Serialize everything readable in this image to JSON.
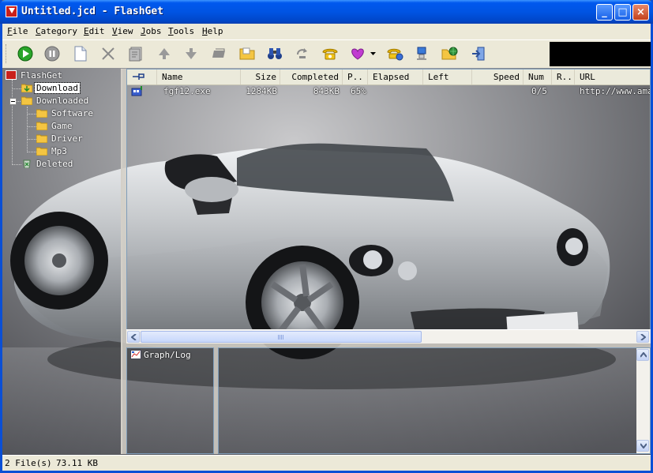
{
  "window": {
    "title": "Untitled.jcd - FlashGet",
    "minimize_glyph": "_",
    "maximize_glyph": "□",
    "close_glyph": "×"
  },
  "menu": [
    {
      "label": "File",
      "accel": "F"
    },
    {
      "label": "Category",
      "accel": "C"
    },
    {
      "label": "Edit",
      "accel": "E"
    },
    {
      "label": "View",
      "accel": "V"
    },
    {
      "label": "Jobs",
      "accel": "J"
    },
    {
      "label": "Tools",
      "accel": "T"
    },
    {
      "label": "Help",
      "accel": "H"
    }
  ],
  "toolbar": {
    "buttons": [
      {
        "name": "start",
        "icon": "play-icon"
      },
      {
        "name": "pause",
        "icon": "pause-icon"
      },
      {
        "name": "new",
        "icon": "new-page-icon"
      },
      {
        "name": "delete",
        "icon": "delete-x-icon"
      },
      {
        "name": "properties",
        "icon": "properties-icon"
      },
      {
        "name": "move-up",
        "icon": "arrow-up-icon"
      },
      {
        "name": "move-down",
        "icon": "arrow-down-icon"
      },
      {
        "name": "open-file",
        "icon": "open-file-icon"
      },
      {
        "name": "open-folder",
        "icon": "folder-icon"
      },
      {
        "name": "find",
        "icon": "binoculars-icon"
      },
      {
        "name": "find-next",
        "icon": "find-next-icon"
      },
      {
        "name": "dial",
        "icon": "phone-icon"
      },
      {
        "name": "skin",
        "icon": "heart-icon"
      },
      {
        "name": "connect",
        "icon": "connect-icon"
      },
      {
        "name": "options",
        "icon": "options-icon"
      },
      {
        "name": "site-explorer",
        "icon": "globe-icon"
      },
      {
        "name": "exit",
        "icon": "exit-icon"
      }
    ]
  },
  "tree": {
    "root": "FlashGet",
    "download": "Download",
    "downloaded": "Downloaded",
    "software": "Software",
    "game": "Game",
    "driver": "Driver",
    "mp3": "Mp3",
    "deleted": "Deleted"
  },
  "list": {
    "columns": [
      "",
      "Name",
      "Size",
      "Completed",
      "P..",
      "Elapsed",
      "Left",
      "Speed",
      "Num",
      "R..",
      "URL"
    ],
    "rows": [
      {
        "status_icon": "downloading-icon",
        "name": "fgf12.exe",
        "size": "1284KB",
        "completed": "843KB",
        "percent": "65%",
        "elapsed": "",
        "left": "",
        "speed": "",
        "num": "0/5",
        "resume": "",
        "url": "http://www.amazesoft.com"
      }
    ]
  },
  "log": {
    "tab_label": "Graph/Log"
  },
  "status": {
    "files": "2 File(s)",
    "size": "73.11 KB"
  },
  "colors": {
    "titlebar": "#0054e3",
    "chrome": "#ece9d8",
    "panel_border": "#7f9db9"
  }
}
